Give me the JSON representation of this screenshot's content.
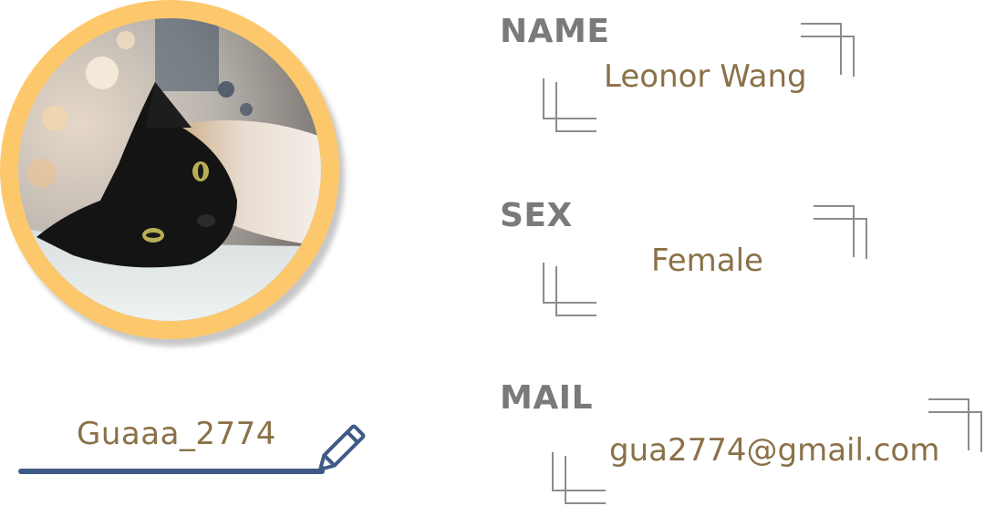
{
  "profile": {
    "username": "Guaaa_2774",
    "edit_icon": "pencil-icon",
    "avatar_alt": "cat-photo"
  },
  "fields": {
    "name": {
      "label": "NAME",
      "value": "Leonor Wang"
    },
    "sex": {
      "label": "SEX",
      "value": "Female"
    },
    "mail": {
      "label": "MAIL",
      "value": "gua2774@gmail.com"
    }
  },
  "colors": {
    "ring": "#fdc86c",
    "label": "#7a7a7a",
    "value": "#8a7147",
    "underline": "#3f5a86",
    "bracket": "#8c8c8c"
  }
}
